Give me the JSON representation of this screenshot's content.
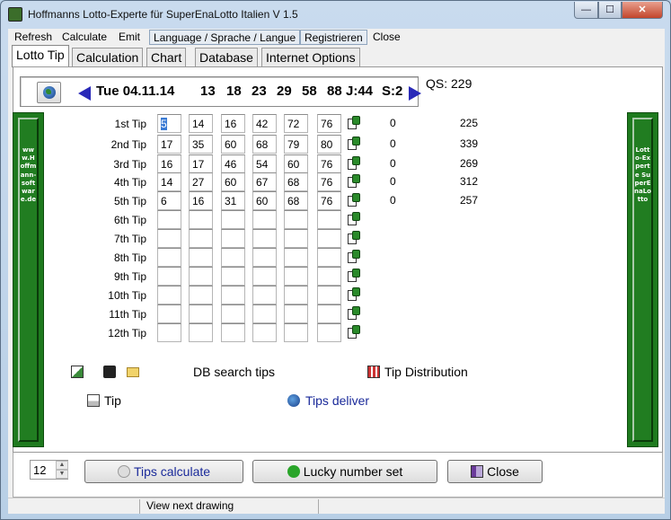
{
  "window": {
    "title": "Hoffmanns Lotto-Experte  für SuperEnaLotto Italien V 1.5",
    "min": "—",
    "max": "☐",
    "close": "✕"
  },
  "menu": [
    "Refresh",
    "Calculate",
    "Emit",
    "Language / Sprache / Langue",
    "Registrieren",
    "Close"
  ],
  "tabs": [
    "Lotto Tip",
    "Calculation",
    "Chart",
    "Database",
    "Internet Options"
  ],
  "drawing": {
    "date": "Tue 04.11.14",
    "numbers": [
      "13",
      "18",
      "23",
      "29",
      "58",
      "88"
    ],
    "jolly": "J:44",
    "superstar": "S:2",
    "qs": "QS: 229"
  },
  "side_left": "www.Hoffmann-software.de",
  "side_right": "Lotto-Experte SuperEnaLotto",
  "tips": [
    {
      "label": "1st Tip",
      "nums": [
        "5",
        "14",
        "16",
        "42",
        "72",
        "76"
      ],
      "hits": "0",
      "qs": "225"
    },
    {
      "label": "2nd Tip",
      "nums": [
        "17",
        "35",
        "60",
        "68",
        "79",
        "80"
      ],
      "hits": "0",
      "qs": "339"
    },
    {
      "label": "3rd Tip",
      "nums": [
        "16",
        "17",
        "46",
        "54",
        "60",
        "76"
      ],
      "hits": "0",
      "qs": "269"
    },
    {
      "label": "4th Tip",
      "nums": [
        "14",
        "27",
        "60",
        "67",
        "68",
        "76"
      ],
      "hits": "0",
      "qs": "312"
    },
    {
      "label": "5th Tip",
      "nums": [
        "6",
        "16",
        "31",
        "60",
        "68",
        "76"
      ],
      "hits": "0",
      "qs": "257"
    },
    {
      "label": "6th Tip",
      "nums": [
        "",
        "",
        "",
        "",
        "",
        ""
      ],
      "hits": "",
      "qs": ""
    },
    {
      "label": "7th Tip",
      "nums": [
        "",
        "",
        "",
        "",
        "",
        ""
      ],
      "hits": "",
      "qs": ""
    },
    {
      "label": "8th Tip",
      "nums": [
        "",
        "",
        "",
        "",
        "",
        ""
      ],
      "hits": "",
      "qs": ""
    },
    {
      "label": "9th Tip",
      "nums": [
        "",
        "",
        "",
        "",
        "",
        ""
      ],
      "hits": "",
      "qs": ""
    },
    {
      "label": "10th Tip",
      "nums": [
        "",
        "",
        "",
        "",
        "",
        ""
      ],
      "hits": "",
      "qs": ""
    },
    {
      "label": "11th Tip",
      "nums": [
        "",
        "",
        "",
        "",
        "",
        ""
      ],
      "hits": "",
      "qs": ""
    },
    {
      "label": "12th Tip",
      "nums": [
        "",
        "",
        "",
        "",
        "",
        ""
      ],
      "hits": "",
      "qs": ""
    }
  ],
  "tools": {
    "db_search": "DB search tips",
    "tip_distribution": "Tip Distribution",
    "print_tip": "Tip",
    "tips_deliver": "Tips deliver"
  },
  "bottom": {
    "count": "12",
    "tips_calculate": "Tips calculate",
    "lucky_number": "Lucky number set",
    "close": "Close"
  },
  "status": "View next drawing"
}
